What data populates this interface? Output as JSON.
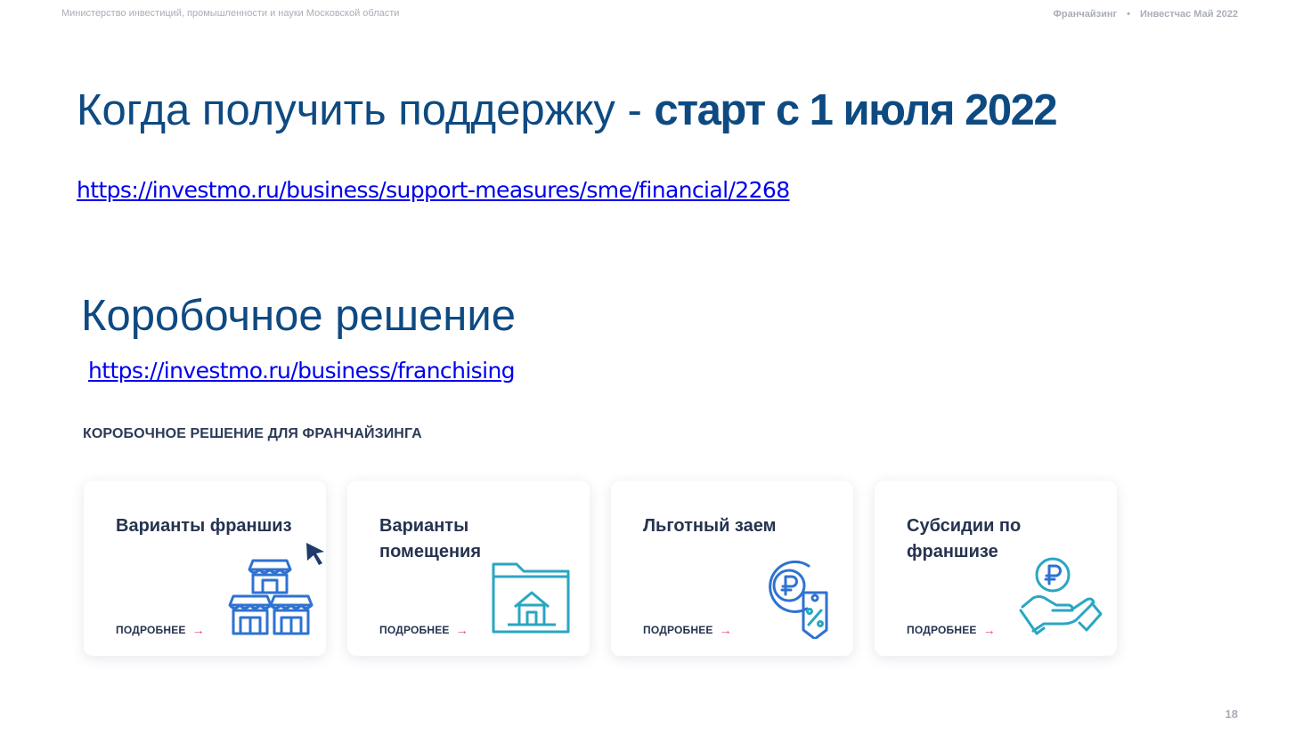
{
  "header": {
    "ministry": "Министерство инвестиций, промышленности и науки Московской области",
    "topic": "Франчайзинг",
    "separator": "•",
    "event": "Инвестчас Май 2022"
  },
  "title": {
    "regular": "Когда получить поддержку - ",
    "bold": "старт с 1 июля 2022"
  },
  "link_support": "https://investmo.ru/business/support-measures/sme/financial/2268",
  "subtitle": "Коробочное решение",
  "link_franchising": "https://investmo.ru/business/franchising",
  "section_heading": "КОРОБОЧНОЕ РЕШЕНИЕ ДЛЯ ФРАНЧАЙЗИНГА",
  "cards": [
    {
      "title": "Варианты франшиз",
      "more": "ПОДРОБНЕЕ",
      "icon": "shops-icon"
    },
    {
      "title": "Варианты помещения",
      "more": "ПОДРОБНЕЕ",
      "icon": "folder-house-icon"
    },
    {
      "title": "Льготный заем",
      "more": "ПОДРОБНЕЕ",
      "icon": "ruble-coin-tag-icon"
    },
    {
      "title": "Субсидии по франшизе",
      "more": "ПОДРОБНЕЕ",
      "icon": "hand-ruble-icon"
    }
  ],
  "page_number": "18",
  "colors": {
    "title_blue": "#0e4a82",
    "link_blue": "#0000ee",
    "accent_pink": "#e8406a",
    "icon_blue": "#2e72d2",
    "icon_teal": "#2aa6c2"
  }
}
